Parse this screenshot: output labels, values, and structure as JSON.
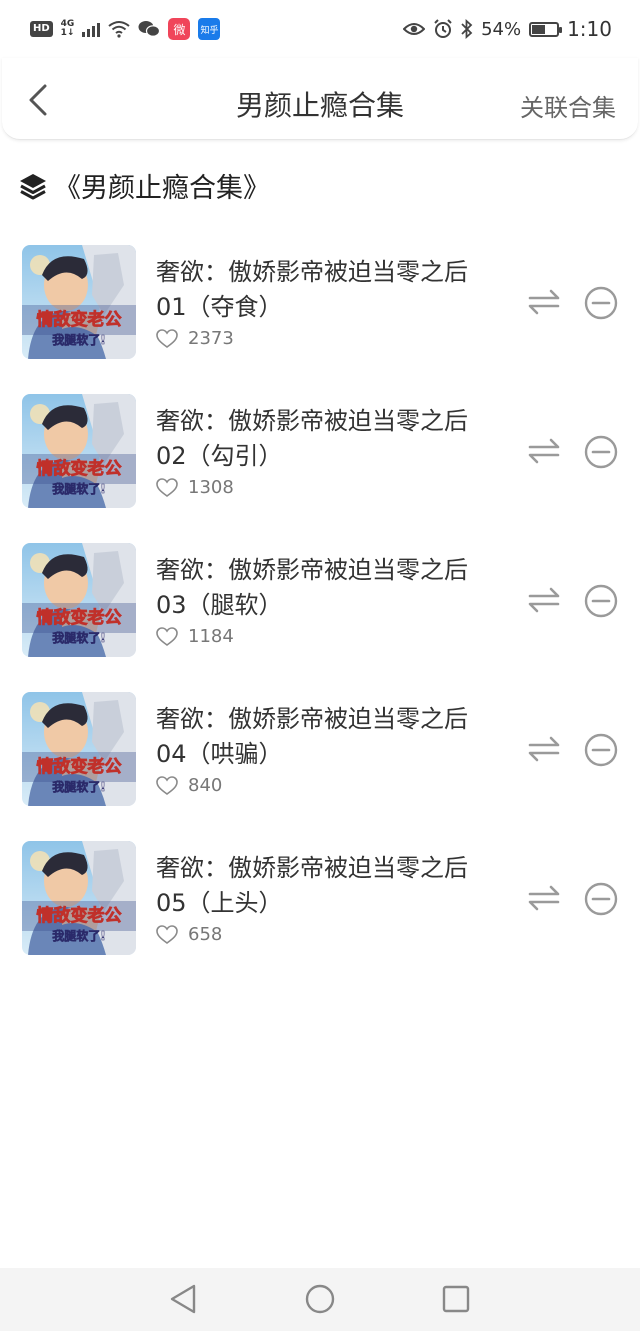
{
  "status_bar": {
    "hd": "HD",
    "network": "4G",
    "network_sub": "1↓",
    "zhihu_label": "知乎",
    "weibo_label": "微",
    "battery": "54%",
    "battery_level": 0.54,
    "time": "1:10"
  },
  "header": {
    "title": "男颜止瘾合集",
    "related_label": "关联合集"
  },
  "collection": {
    "heading": "《男颜止瘾合集》"
  },
  "cover": {
    "title_text": "情敌变老公",
    "subtitle_text": "我腿软了!"
  },
  "episodes": [
    {
      "title_line1": "奢欲：傲娇影帝被迫当零之后",
      "title_line2": "01（夺食）",
      "likes": "2373"
    },
    {
      "title_line1": "奢欲：傲娇影帝被迫当零之后",
      "title_line2": "02（勾引）",
      "likes": "1308"
    },
    {
      "title_line1": "奢欲：傲娇影帝被迫当零之后",
      "title_line2": "03（腿软）",
      "likes": "1184"
    },
    {
      "title_line1": "奢欲：傲娇影帝被迫当零之后",
      "title_line2": "04（哄骗）",
      "likes": "840"
    },
    {
      "title_line1": "奢欲：傲娇影帝被迫当零之后",
      "title_line2": "05（上头）",
      "likes": "658"
    }
  ],
  "colors": {
    "icon_gray": "#9a9a9a",
    "cover_title": "#ffffff",
    "cover_title_stroke": "#c0302a",
    "cover_band": "#3a4e8c"
  }
}
